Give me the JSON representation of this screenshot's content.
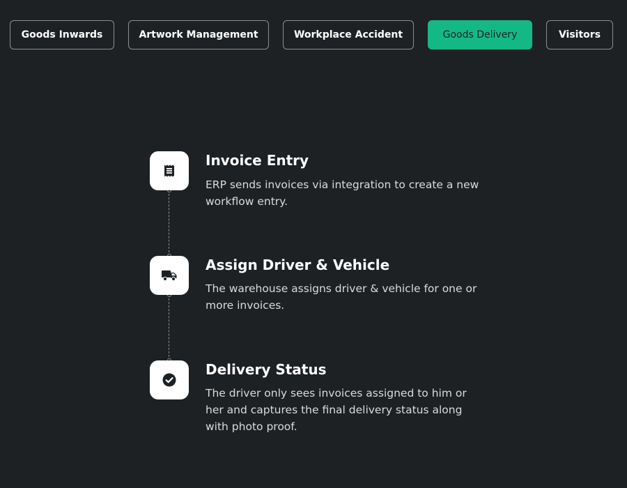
{
  "tabs": [
    {
      "label": "Goods Inwards",
      "active": false
    },
    {
      "label": "Artwork Management",
      "active": false
    },
    {
      "label": "Workplace Accident",
      "active": false
    },
    {
      "label": "Goods Delivery",
      "active": true
    },
    {
      "label": "Visitors",
      "active": false
    }
  ],
  "steps": [
    {
      "icon": "receipt-icon",
      "title": "Invoice Entry",
      "description": "ERP sends invoices via integration to create a new workflow entry."
    },
    {
      "icon": "truck-icon",
      "title": "Assign Driver & Vehicle",
      "description": "The warehouse assigns driver & vehicle for one or more invoices."
    },
    {
      "icon": "check-circle-icon",
      "title": "Delivery Status",
      "description": "The driver only sees invoices assigned to him or her and captures the final delivery status along with photo proof."
    }
  ],
  "colors": {
    "background": "#1e2124",
    "accent": "#14b885",
    "tab_border": "#8b8f93",
    "card": "#ffffff"
  }
}
